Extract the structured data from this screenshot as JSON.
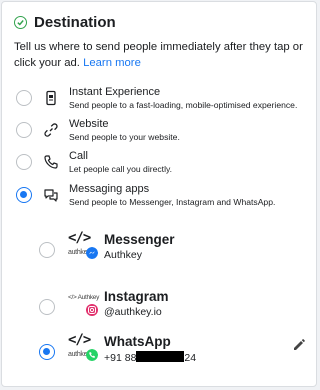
{
  "section": {
    "title": "Destination",
    "description": "Tell us where to send people immediately after they tap or click your ad.",
    "learn_more": "Learn more"
  },
  "options": [
    {
      "label": "Instant Experience",
      "sub": "Send people to a fast-loading, mobile-optimised experience.",
      "icon": "instant-experience-icon",
      "selected": false
    },
    {
      "label": "Website",
      "sub": "Send people to your website.",
      "icon": "link-icon",
      "selected": false
    },
    {
      "label": "Call",
      "sub": "Let people call you directly.",
      "icon": "phone-icon",
      "selected": false
    },
    {
      "label": "Messaging apps",
      "sub": "Send people to Messenger, Instagram and WhatsApp.",
      "icon": "chat-bubbles-icon",
      "selected": true
    }
  ],
  "apps": [
    {
      "name": "Messenger",
      "account": "Authkey",
      "brand_text": "authkey",
      "badge": "messenger-icon",
      "selected": false
    },
    {
      "name": "Instagram",
      "account": "@authkey.io",
      "brand_text": "</> Authkey",
      "badge": "instagram-icon",
      "selected": false
    },
    {
      "name": "WhatsApp",
      "account_prefix": "+91 88",
      "account_suffix": "24",
      "brand_text": "authkey",
      "badge": "whatsapp-icon",
      "selected": true
    }
  ],
  "colors": {
    "accent": "#1877f2",
    "success": "#31a24c",
    "whatsapp": "#25d366",
    "instagram": "#e1306c"
  }
}
